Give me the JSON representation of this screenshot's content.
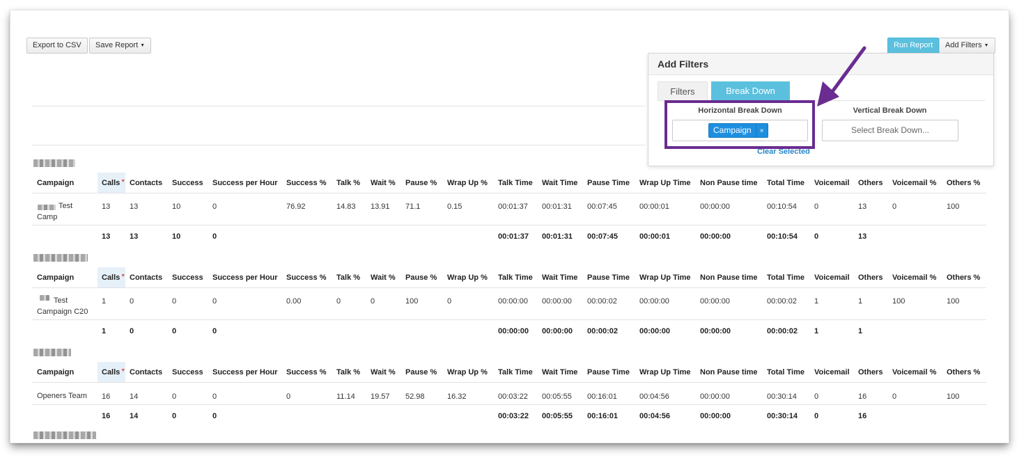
{
  "toolbar": {
    "export_label": "Export to CSV",
    "save_label": "Save Report",
    "run_label": "Run Report",
    "add_filters_label": "Add Filters"
  },
  "filter_panel": {
    "title": "Add Filters",
    "tabs": [
      {
        "label": "Filters",
        "active": false
      },
      {
        "label": "Break Down",
        "active": true
      }
    ],
    "horizontal_label": "Horizontal Break Down",
    "horizontal_selected": "Campaign",
    "tag_remove": "×",
    "vertical_label": "Vertical Break Down",
    "vertical_placeholder": "Select Break Down...",
    "clear_label": "Clear Selected"
  },
  "columns": [
    "Campaign",
    "Calls",
    "Contacts",
    "Success",
    "Success per Hour",
    "Success %",
    "Talk %",
    "Wait %",
    "Pause %",
    "Wrap Up %",
    "Talk Time",
    "Wait Time",
    "Pause Time",
    "Wrap Up Time",
    "Non Pause time",
    "Total Time",
    "Voicemail",
    "Others",
    "Voicemail %",
    "Others %"
  ],
  "groups": [
    {
      "row": [
        "Test\nCamp",
        "13",
        "13",
        "10",
        "0",
        "76.92",
        "14.83",
        "13.91",
        "71.1",
        "0.15",
        "00:01:37",
        "00:01:31",
        "00:07:45",
        "00:00:01",
        "00:00:00",
        "00:10:54",
        "0",
        "13",
        "0",
        "100"
      ],
      "total": [
        "",
        "13",
        "13",
        "10",
        "0",
        "",
        "",
        "",
        "",
        "",
        "00:01:37",
        "00:01:31",
        "00:07:45",
        "00:00:01",
        "00:00:00",
        "00:10:54",
        "0",
        "13",
        "",
        ""
      ]
    },
    {
      "row": [
        "Test\nCampaign C20",
        "1",
        "0",
        "0",
        "0",
        "0.00",
        "0",
        "0",
        "100",
        "0",
        "00:00:00",
        "00:00:00",
        "00:00:02",
        "00:00:00",
        "00:00:00",
        "00:00:02",
        "1",
        "1",
        "100",
        "100"
      ],
      "total": [
        "",
        "1",
        "0",
        "0",
        "0",
        "",
        "",
        "",
        "",
        "",
        "00:00:00",
        "00:00:00",
        "00:00:02",
        "00:00:00",
        "00:00:00",
        "00:00:02",
        "1",
        "1",
        "",
        ""
      ]
    },
    {
      "row": [
        "Openers Team",
        "16",
        "14",
        "0",
        "0",
        "0",
        "11.14",
        "19.57",
        "52.98",
        "16.32",
        "00:03:22",
        "00:05:55",
        "00:16:01",
        "00:04:56",
        "00:00:00",
        "00:30:14",
        "0",
        "16",
        "0",
        "100"
      ],
      "total": [
        "",
        "16",
        "14",
        "0",
        "0",
        "",
        "",
        "",
        "",
        "",
        "00:03:22",
        "00:05:55",
        "00:16:01",
        "00:04:56",
        "00:00:00",
        "00:30:14",
        "0",
        "16",
        "",
        ""
      ]
    }
  ]
}
